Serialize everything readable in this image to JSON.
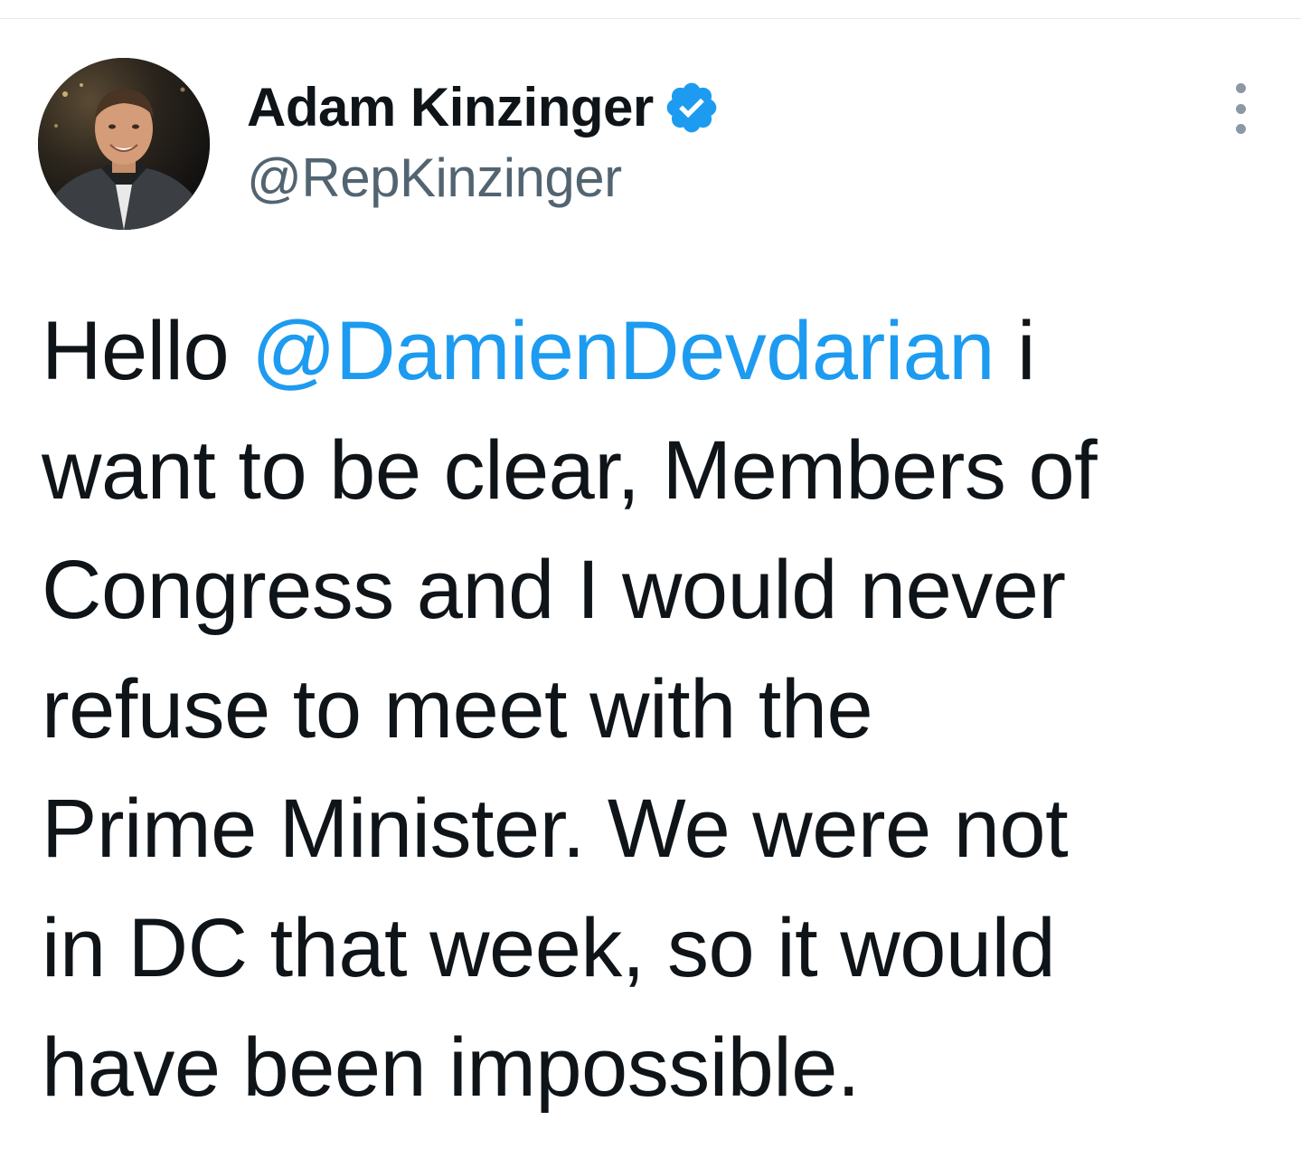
{
  "tweet": {
    "author": {
      "display_name": "Adam Kinzinger",
      "handle": "@RepKinzinger",
      "verified": true,
      "avatar_icon": "profile-photo"
    },
    "more_icon": "more-vertical-icon",
    "text": {
      "line1_before": "Hello ",
      "line1_mention": "@DamienDevdarian",
      "line1_after": " i",
      "line2": "want to be clear, Members of",
      "line3": "Congress and I would never",
      "line4": "refuse to meet with the",
      "line5": "Prime Minister.  We were not",
      "line6": "in DC that week, so it would",
      "line7": "have been impossible."
    }
  },
  "colors": {
    "text_primary": "#0f1419",
    "text_secondary": "#536471",
    "link": "#1d9bf0",
    "verified_badge": "#1d9bf0",
    "divider": "#e6e9ec"
  }
}
